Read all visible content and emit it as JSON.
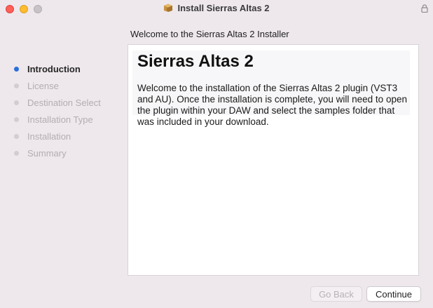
{
  "window": {
    "title": "Install Sierras Altas 2",
    "subtitle": "Welcome to the Sierras Altas 2 Installer"
  },
  "steps": [
    {
      "label": "Introduction",
      "active": true
    },
    {
      "label": "License",
      "active": false
    },
    {
      "label": "Destination Select",
      "active": false
    },
    {
      "label": "Installation Type",
      "active": false
    },
    {
      "label": "Installation",
      "active": false
    },
    {
      "label": "Summary",
      "active": false
    }
  ],
  "content": {
    "heading": "Sierras Altas 2",
    "body": "Welcome to the installation of the Sierras Altas 2 plugin (VST3 and AU). Once the installation is complete, you will need to open the plugin within your DAW and select the samples folder that was included in your download."
  },
  "buttons": {
    "back": "Go Back",
    "continue": "Continue"
  },
  "colors": {
    "accent": "#2b6fd9",
    "close": "#fe5f57",
    "minimize": "#febc2e",
    "zoom_disabled": "#c8c3c7"
  },
  "icons": {
    "title_icon": "package-icon",
    "lock": "lock-icon"
  }
}
